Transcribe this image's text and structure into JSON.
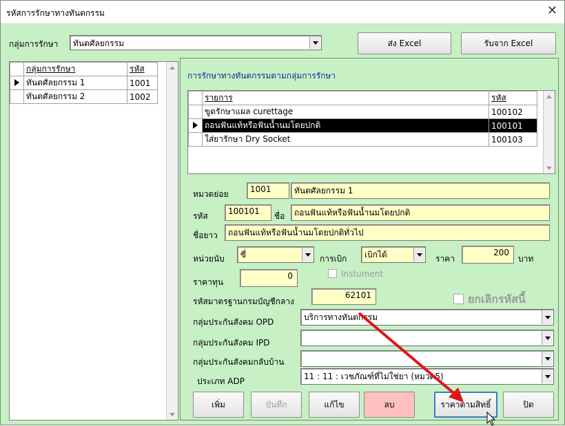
{
  "window": {
    "title": "รหัสการรักษาทางทันตกรรม",
    "close_glyph": "✕"
  },
  "top": {
    "group_label": "กลุ่มการรักษา",
    "group_value": "ทันตศัลยกรรม",
    "send_excel": "ส่ง Excel",
    "receive_excel": "รับจาก Excel"
  },
  "left_grid": {
    "headers": [
      "กลุ่มการรักษา",
      "รหัส"
    ],
    "rows": [
      {
        "name": "ทันตศัลยกรรม 1",
        "code": "1001"
      },
      {
        "name": "ทันตศัลยกรรม 2",
        "code": "1002"
      }
    ]
  },
  "panel": {
    "title": "การรักษาทางทันตกรรมตามกลุ่มการรักษา",
    "grid_headers": [
      "รายการ",
      "รหัส"
    ],
    "grid_rows": [
      {
        "name": "ขูดรักษาแผล curettage",
        "code": "100102"
      },
      {
        "name": "ถอนฟันแท้หรือฟันน้ำนมโดยปกติ",
        "code": "100101"
      },
      {
        "name": "ใส่ยารักษา Dry Socket",
        "code": "100103"
      }
    ],
    "subcategory_label": "หมวดย่อย",
    "subcategory_code": "1001",
    "subcategory_name": "ทันตศัลยกรรม 1",
    "code_label": "รหัส",
    "code_value": "100101",
    "name_label": "ชื่อ",
    "name_value": "ถอนฟันแท้หรือฟันน้ำนมโดยปกติ",
    "longname_label": "ชื่อยาว",
    "longname_value": "ถอนฟันแท้หรือฟันน้ำนมโดยปกติทั่วไป",
    "unit_label": "หน่วยนับ",
    "unit_value": "ซี่",
    "claim_label": "การเบิก",
    "claim_value": "เบิกได้",
    "price_label": "ราคา",
    "price_value": "200",
    "baht_label": "บาท",
    "cost_label": "ราคาทุน",
    "cost_value": "0",
    "instrument_label": "Instument",
    "standard_code_label": "รหัสมาตรฐานกรมบัญชีกลาง",
    "standard_code_value": "62101",
    "cancel_label": "ยกเลิกรหัสนี้",
    "opd_label": "กลุ่มประกันสังคม OPD",
    "opd_value": "บริการทางทันตกรรม",
    "ipd_label": "กลุ่มประกันสังคม IPD",
    "ipd_value": "",
    "home_label": "กลุ่มประกันสังคมกลับบ้าน",
    "home_value": "",
    "adp_label": "ประเภท ADP",
    "adp_value": "11 : 11 : เวชภัณฑ์ที่ไม่ใช่ยา (หมวด5)"
  },
  "buttons": {
    "add": "เพิ่ม",
    "save": "บันทึก",
    "edit": "แก้ไข",
    "delete": "ลบ",
    "price_by_right": "ราคาตามสิทธิ์",
    "close": "ปิด"
  },
  "colors": {
    "background": "#c7f0c4",
    "field": "#ffffc6",
    "delete_button": "#ffc0c0",
    "arrow": "#e01515"
  }
}
